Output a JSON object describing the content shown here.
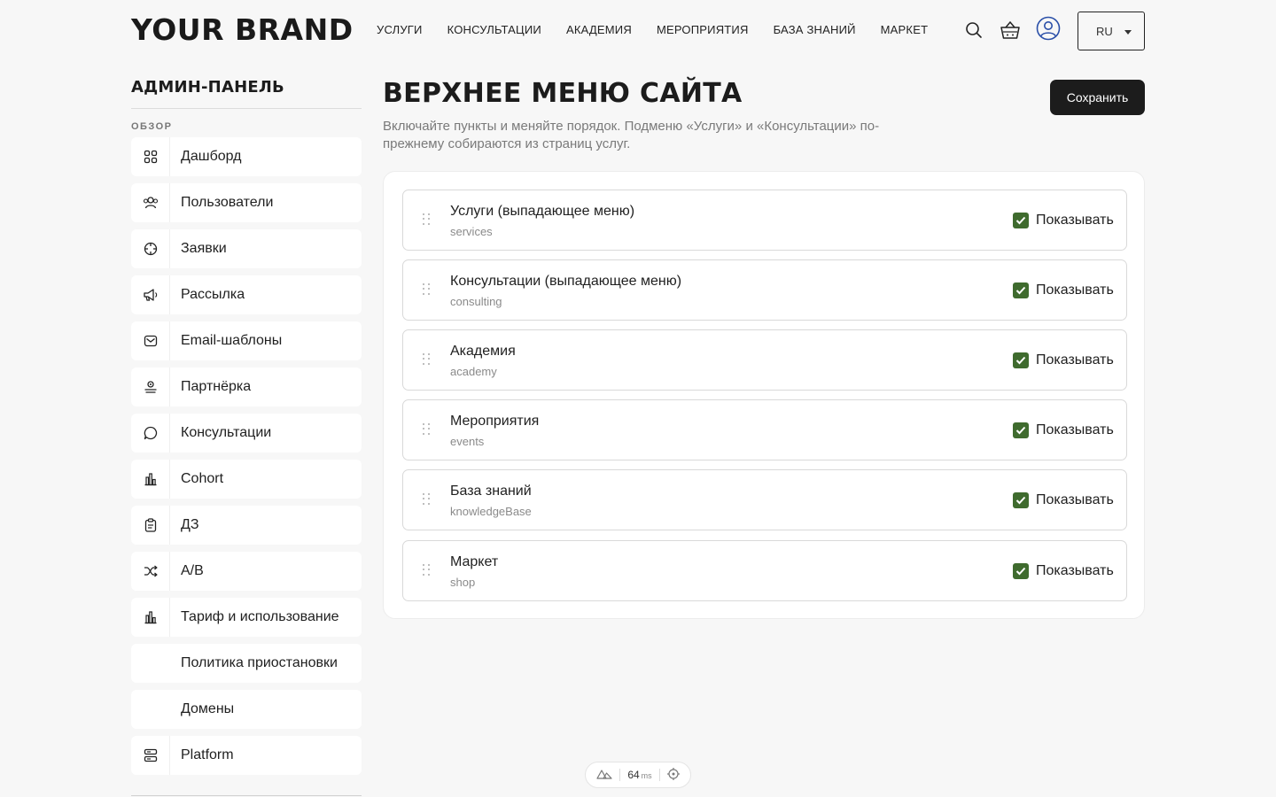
{
  "header": {
    "brand": "YOUR BRAND",
    "nav": [
      "УСЛУГИ",
      "КОНСУЛЬТАЦИИ",
      "АКАДЕМИЯ",
      "МЕРОПРИЯТИЯ",
      "БАЗА ЗНАНИЙ",
      "МАРКЕТ"
    ],
    "icons": [
      "search-icon",
      "basket-icon",
      "user-icon"
    ],
    "language": "RU"
  },
  "sidebar": {
    "title": "АДМИН-ПАНЕЛЬ",
    "section": "ОБЗОР",
    "items": [
      {
        "label": "Дашборд",
        "icon": "dashboard-icon"
      },
      {
        "label": "Пользователи",
        "icon": "users-icon"
      },
      {
        "label": "Заявки",
        "icon": "target-icon"
      },
      {
        "label": "Рассылка",
        "icon": "megaphone-icon"
      },
      {
        "label": "Email-шаблоны",
        "icon": "mail-icon"
      },
      {
        "label": "Партнёрка",
        "icon": "partner-icon"
      },
      {
        "label": "Консультации",
        "icon": "chat-icon"
      },
      {
        "label": "Cohort",
        "icon": "bar-chart-icon"
      },
      {
        "label": "ДЗ",
        "icon": "clipboard-icon"
      },
      {
        "label": "A/B",
        "icon": "shuffle-icon"
      },
      {
        "label": "Тариф и использование",
        "icon": "bar-chart-icon"
      },
      {
        "label": "Политика приостановки",
        "icon": ""
      },
      {
        "label": "Домены",
        "icon": ""
      },
      {
        "label": "Platform",
        "icon": "server-icon"
      }
    ]
  },
  "main": {
    "title": "ВЕРХНЕЕ МЕНЮ САЙТА",
    "description": "Включайте пункты и меняйте порядок. Подменю «Услуги» и «Консультации» по-прежнему собираются из страниц услуг.",
    "save_label": "Сохранить",
    "rows": [
      {
        "title": "Услуги (выпадающее меню)",
        "key": "services",
        "checked": true,
        "toggle_label": "Показывать"
      },
      {
        "title": "Консультации (выпадающее меню)",
        "key": "consulting",
        "checked": true,
        "toggle_label": "Показывать"
      },
      {
        "title": "Академия",
        "key": "academy",
        "checked": true,
        "toggle_label": "Показывать"
      },
      {
        "title": "Мероприятия",
        "key": "events",
        "checked": true,
        "toggle_label": "Показывать"
      },
      {
        "title": "База знаний",
        "key": "knowledgeBase",
        "checked": true,
        "toggle_label": "Показывать"
      },
      {
        "title": "Маркет",
        "key": "shop",
        "checked": true,
        "toggle_label": "Показывать"
      }
    ],
    "accent_color": "#3f6b2e"
  },
  "devtools": {
    "timing_value": "64",
    "timing_unit": "ms"
  }
}
